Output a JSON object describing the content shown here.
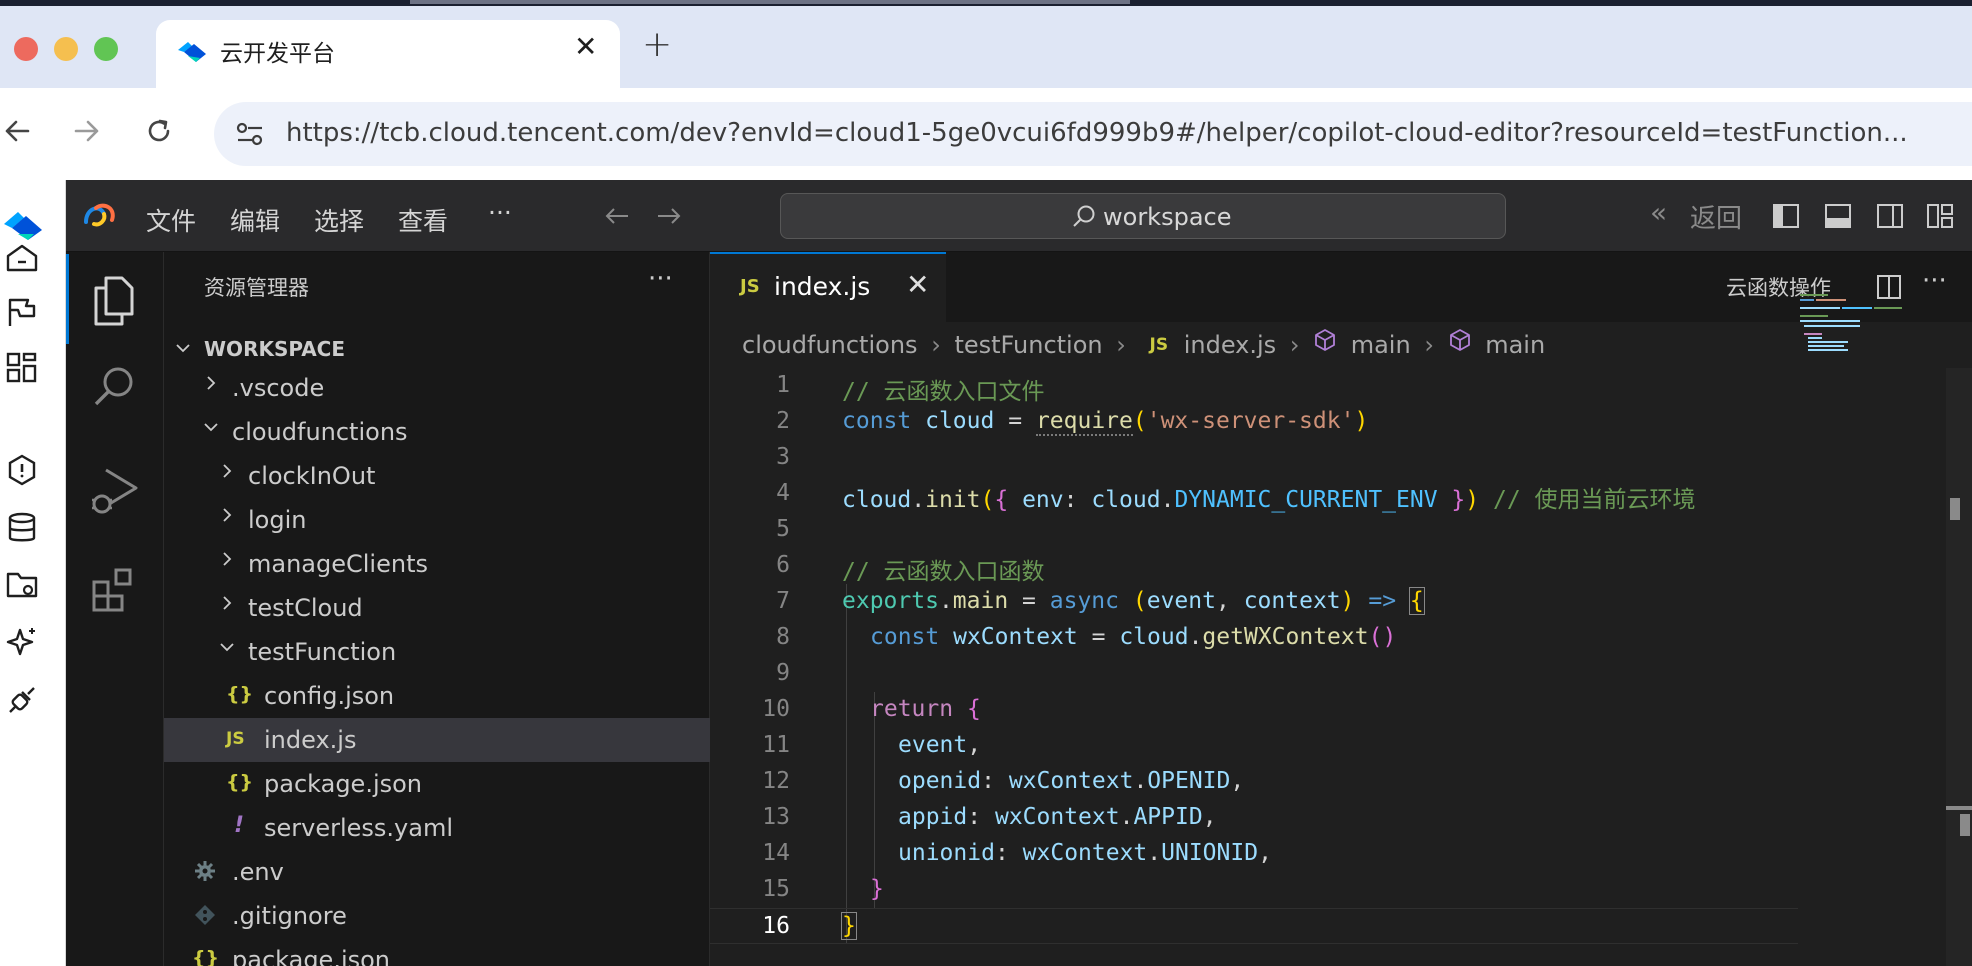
{
  "browser": {
    "tab_title": "云开发平台",
    "tab_close": "✕",
    "new_tab": "+",
    "url": "https://tcb.cloud.tencent.com/dev?envId=cloud1-5ge0vcui6fd999b9#/helper/copilot-cloud-editor?resourceId=testFunction..."
  },
  "vscode": {
    "menu": [
      "文件",
      "编辑",
      "选择",
      "查看",
      "···"
    ],
    "command_center": "workspace",
    "back_label": "返回",
    "explorer": {
      "header": "资源管理器",
      "more": "···",
      "workspace": "WORKSPACE",
      "items": [
        {
          "label": ".vscode"
        },
        {
          "label": "cloudfunctions"
        },
        {
          "label": "clockInOut"
        },
        {
          "label": "login"
        },
        {
          "label": "manageClients"
        },
        {
          "label": "testCloud"
        },
        {
          "label": "testFunction"
        },
        {
          "label": "config.json",
          "icon": "{}"
        },
        {
          "label": "index.js",
          "icon": "JS"
        },
        {
          "label": "package.json",
          "icon": "{}"
        },
        {
          "label": "serverless.yaml",
          "icon": "!"
        },
        {
          "label": ".env"
        },
        {
          "label": ".gitignore"
        },
        {
          "label": "package.json",
          "icon": "{}"
        }
      ]
    },
    "editor": {
      "tab_label": "index.js",
      "tab_icon": "JS",
      "tab_close": "✕",
      "actions_label": "云函数操作",
      "actions_more": "···",
      "breadcrumbs": [
        "cloudfunctions",
        "testFunction",
        "index.js",
        "main",
        "main"
      ],
      "line_numbers": [
        "1",
        "2",
        "3",
        "4",
        "5",
        "6",
        "7",
        "8",
        "9",
        "10",
        "11",
        "12",
        "13",
        "14",
        "15",
        "16"
      ],
      "tokens": {
        "l1c": "// 云函数入口文件",
        "l2a": "const",
        "l2b": "cloud",
        "l2c": "=",
        "l2d": "require",
        "l2e": "(",
        "l2f": "'wx-server-sdk'",
        "l2g": ")",
        "l4a": "cloud",
        "l4b": ".",
        "l4c": "init",
        "l4d": "(",
        "l4e": "{",
        "l4f": "env",
        "l4g": ":",
        "l4h": "cloud",
        "l4i": ".",
        "l4j": "DYNAMIC_CURRENT_ENV",
        "l4k": "}",
        "l4l": ")",
        "l4m": "// 使用当前云环境",
        "l6c": "// 云函数入口函数",
        "l7a": "exports",
        "l7b": ".",
        "l7c": "main",
        "l7d": "=",
        "l7e": "async",
        "l7f": "(",
        "l7g": "event",
        "l7h": ",",
        "l7i": "context",
        "l7j": ")",
        "l7k": "=>",
        "l7l": "{",
        "l8a": "const",
        "l8b": "wxContext",
        "l8c": "=",
        "l8d": "cloud",
        "l8e": ".",
        "l8f": "getWXContext",
        "l8g": "()",
        "l10a": "return",
        "l10b": "{",
        "l11a": "event",
        "l11b": ",",
        "l12a": "openid",
        "l12b": ":",
        "l12c": "wxContext",
        "l12d": ".",
        "l12e": "OPENID",
        "l12f": ",",
        "l13a": "appid",
        "l13b": ":",
        "l13c": "wxContext",
        "l13d": ".",
        "l13e": "APPID",
        "l13f": ",",
        "l14a": "unionid",
        "l14b": ":",
        "l14c": "wxContext",
        "l14d": ".",
        "l14e": "UNIONID",
        "l14f": ",",
        "l15a": "}",
        "l16a": "}"
      }
    }
  },
  "colors": {
    "accent": "#0078d4",
    "js_icon": "#cbcb41",
    "keyword": "#569cd6",
    "comment": "#6a9955",
    "string": "#ce9178"
  }
}
